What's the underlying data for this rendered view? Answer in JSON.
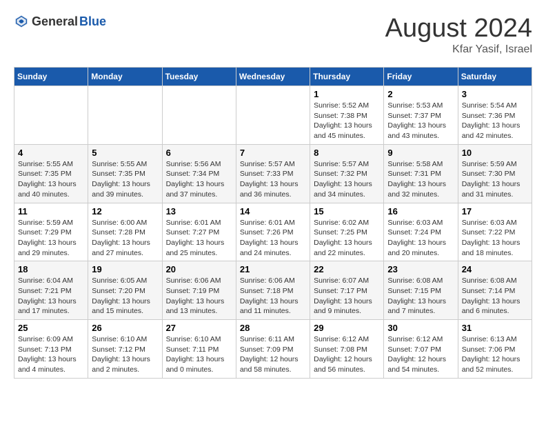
{
  "header": {
    "logo_general": "General",
    "logo_blue": "Blue",
    "title": "August 2024",
    "subtitle": "Kfar Yasif, Israel"
  },
  "weekdays": [
    "Sunday",
    "Monday",
    "Tuesday",
    "Wednesday",
    "Thursday",
    "Friday",
    "Saturday"
  ],
  "weeks": [
    [
      {
        "day": "",
        "info": ""
      },
      {
        "day": "",
        "info": ""
      },
      {
        "day": "",
        "info": ""
      },
      {
        "day": "",
        "info": ""
      },
      {
        "day": "1",
        "info": "Sunrise: 5:52 AM\nSunset: 7:38 PM\nDaylight: 13 hours and 45 minutes."
      },
      {
        "day": "2",
        "info": "Sunrise: 5:53 AM\nSunset: 7:37 PM\nDaylight: 13 hours and 43 minutes."
      },
      {
        "day": "3",
        "info": "Sunrise: 5:54 AM\nSunset: 7:36 PM\nDaylight: 13 hours and 42 minutes."
      }
    ],
    [
      {
        "day": "4",
        "info": "Sunrise: 5:55 AM\nSunset: 7:35 PM\nDaylight: 13 hours and 40 minutes."
      },
      {
        "day": "5",
        "info": "Sunrise: 5:55 AM\nSunset: 7:35 PM\nDaylight: 13 hours and 39 minutes."
      },
      {
        "day": "6",
        "info": "Sunrise: 5:56 AM\nSunset: 7:34 PM\nDaylight: 13 hours and 37 minutes."
      },
      {
        "day": "7",
        "info": "Sunrise: 5:57 AM\nSunset: 7:33 PM\nDaylight: 13 hours and 36 minutes."
      },
      {
        "day": "8",
        "info": "Sunrise: 5:57 AM\nSunset: 7:32 PM\nDaylight: 13 hours and 34 minutes."
      },
      {
        "day": "9",
        "info": "Sunrise: 5:58 AM\nSunset: 7:31 PM\nDaylight: 13 hours and 32 minutes."
      },
      {
        "day": "10",
        "info": "Sunrise: 5:59 AM\nSunset: 7:30 PM\nDaylight: 13 hours and 31 minutes."
      }
    ],
    [
      {
        "day": "11",
        "info": "Sunrise: 5:59 AM\nSunset: 7:29 PM\nDaylight: 13 hours and 29 minutes."
      },
      {
        "day": "12",
        "info": "Sunrise: 6:00 AM\nSunset: 7:28 PM\nDaylight: 13 hours and 27 minutes."
      },
      {
        "day": "13",
        "info": "Sunrise: 6:01 AM\nSunset: 7:27 PM\nDaylight: 13 hours and 25 minutes."
      },
      {
        "day": "14",
        "info": "Sunrise: 6:01 AM\nSunset: 7:26 PM\nDaylight: 13 hours and 24 minutes."
      },
      {
        "day": "15",
        "info": "Sunrise: 6:02 AM\nSunset: 7:25 PM\nDaylight: 13 hours and 22 minutes."
      },
      {
        "day": "16",
        "info": "Sunrise: 6:03 AM\nSunset: 7:24 PM\nDaylight: 13 hours and 20 minutes."
      },
      {
        "day": "17",
        "info": "Sunrise: 6:03 AM\nSunset: 7:22 PM\nDaylight: 13 hours and 18 minutes."
      }
    ],
    [
      {
        "day": "18",
        "info": "Sunrise: 6:04 AM\nSunset: 7:21 PM\nDaylight: 13 hours and 17 minutes."
      },
      {
        "day": "19",
        "info": "Sunrise: 6:05 AM\nSunset: 7:20 PM\nDaylight: 13 hours and 15 minutes."
      },
      {
        "day": "20",
        "info": "Sunrise: 6:06 AM\nSunset: 7:19 PM\nDaylight: 13 hours and 13 minutes."
      },
      {
        "day": "21",
        "info": "Sunrise: 6:06 AM\nSunset: 7:18 PM\nDaylight: 13 hours and 11 minutes."
      },
      {
        "day": "22",
        "info": "Sunrise: 6:07 AM\nSunset: 7:17 PM\nDaylight: 13 hours and 9 minutes."
      },
      {
        "day": "23",
        "info": "Sunrise: 6:08 AM\nSunset: 7:15 PM\nDaylight: 13 hours and 7 minutes."
      },
      {
        "day": "24",
        "info": "Sunrise: 6:08 AM\nSunset: 7:14 PM\nDaylight: 13 hours and 6 minutes."
      }
    ],
    [
      {
        "day": "25",
        "info": "Sunrise: 6:09 AM\nSunset: 7:13 PM\nDaylight: 13 hours and 4 minutes."
      },
      {
        "day": "26",
        "info": "Sunrise: 6:10 AM\nSunset: 7:12 PM\nDaylight: 13 hours and 2 minutes."
      },
      {
        "day": "27",
        "info": "Sunrise: 6:10 AM\nSunset: 7:11 PM\nDaylight: 13 hours and 0 minutes."
      },
      {
        "day": "28",
        "info": "Sunrise: 6:11 AM\nSunset: 7:09 PM\nDaylight: 12 hours and 58 minutes."
      },
      {
        "day": "29",
        "info": "Sunrise: 6:12 AM\nSunset: 7:08 PM\nDaylight: 12 hours and 56 minutes."
      },
      {
        "day": "30",
        "info": "Sunrise: 6:12 AM\nSunset: 7:07 PM\nDaylight: 12 hours and 54 minutes."
      },
      {
        "day": "31",
        "info": "Sunrise: 6:13 AM\nSunset: 7:06 PM\nDaylight: 12 hours and 52 minutes."
      }
    ]
  ]
}
